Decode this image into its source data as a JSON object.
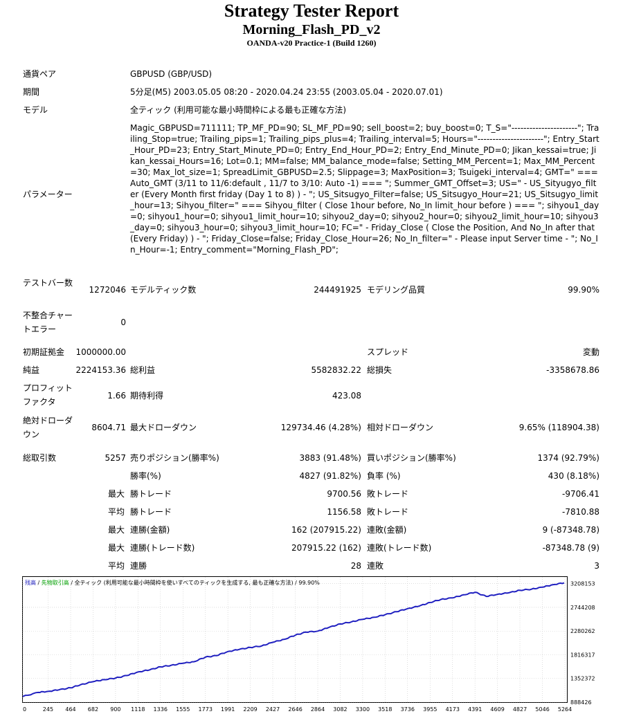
{
  "report": {
    "title": "Strategy Tester Report",
    "ea_name": "Morning_Flash_PD_v2",
    "server": "OANDA-v20 Practice-1 (Build 1260)"
  },
  "info": {
    "pair_label": "通貨ペア",
    "pair_value": "GBPUSD (GBP/USD)",
    "period_label": "期間",
    "period_value": "5分足(M5) 2003.05.05 08:20 - 2020.04.24 23:55 (2003.05.04 - 2020.07.01)",
    "model_label": "モデル",
    "model_value": "全ティック (利用可能な最小時間枠による最も正確な方法)",
    "params_label": "パラメーター",
    "params_value": "Magic_GBPUSD=711111; TP_MF_PD=90; SL_MF_PD=90; sell_boost=2; buy_boost=0; T_S=\"----------------------\"; Trailing_Stop=true; Trailing_pips=1; Trailing_pips_plus=4; Trailing_interval=5; Hours=\"----------------------\"; Entry_Start_Hour_PD=23; Entry_Start_Minute_PD=0; Entry_End_Hour_PD=2; Entry_End_Minute_PD=0; Jikan_kessai=true; Jikan_kessai_Hours=16; Lot=0.1; MM=false; MM_balance_mode=false; Setting_MM_Percent=1; Max_MM_Percent=30; Max_lot_size=1; SpreadLimit_GBPUSD=2.5; Slippage=3; MaxPosition=3; Tsuigeki_interval=4; GMT=\" === Auto_GMT (3/11 to 11/6:default , 11/7 to 3/10: Auto -1) === \"; Summer_GMT_Offset=3; US=\" - US_Sityugyo_filter (Every Month first friday (Day 1 to 8) ) - \"; US_Sitsugyo_Filter=false; US_Sitsugyo_Hour=21; US_Sitsugyo_limit_hour=13; Sihyou_filter=\" === Sihyou_filter ( Close 1hour before, No_In limit_hour before ) === \"; sihyou1_day=0; sihyou1_hour=0; sihyou1_limit_hour=10; sihyou2_day=0; sihyou2_hour=0; sihyou2_limit_hour=10; sihyou3_day=0; sihyou3_hour=0; sihyou3_limit_hour=10; FC=\" - Friday_Close ( Close the Position, And No_In after that (Every Friday) ) - \"; Friday_Close=false; Friday_Close_Hour=26; No_In_filter=\" - Please input Server time - \"; No_In_Hour=-1; Entry_comment=\"Morning_Flash_PD\";"
  },
  "stats": {
    "bars_label": "テストバー数",
    "bars_value": "1272046",
    "ticks_label": "モデルティック数",
    "ticks_value": "244491925",
    "quality_label": "モデリング品質",
    "quality_value": "99.90%",
    "mismatch_label": "不整合チャートエラー",
    "mismatch_value": "0",
    "deposit_label": "初期証拠金",
    "deposit_value": "1000000.00",
    "spread_label": "スプレッド",
    "spread_value": "変動",
    "net_label": "純益",
    "net_value": "2224153.36",
    "gross_profit_label": "総利益",
    "gross_profit_value": "5582832.22",
    "gross_loss_label": "総損失",
    "gross_loss_value": "-3358678.86",
    "pf_label": "プロフィットファクタ",
    "pf_value": "1.66",
    "expected_label": "期待利得",
    "expected_value": "423.08",
    "abs_dd_label": "絶対ドローダウン",
    "abs_dd_value": "8604.71",
    "max_dd_label": "最大ドローダウン",
    "max_dd_value": "129734.46 (4.28%)",
    "rel_dd_label": "相対ドローダウン",
    "rel_dd_value": "9.65% (118904.38)",
    "trades_label": "総取引数",
    "trades_value": "5257",
    "short_label": "売りポジション(勝率%)",
    "short_value": "3883 (91.48%)",
    "long_label": "買いポジション(勝率%)",
    "long_value": "1374 (92.79%)",
    "win_label": "勝率(%)",
    "win_value": "4827 (91.82%)",
    "loss_label": "負率 (%)",
    "loss_value": "430 (8.18%)",
    "pre_max": "最大",
    "pre_avg": "平均",
    "max_win_label": "勝トレード",
    "max_win_value": "9700.56",
    "max_loss_label": "敗トレード",
    "max_loss_value": "-9706.41",
    "avg_win_label": "勝トレード",
    "avg_win_value": "1156.58",
    "avg_loss_label": "敗トレード",
    "avg_loss_value": "-7810.88",
    "cons_win_money_label": "連勝(金額)",
    "cons_win_money_value": "162 (207915.22)",
    "cons_loss_money_label": "連敗(金額)",
    "cons_loss_money_value": "9 (-87348.78)",
    "cons_win_trades_label": "連勝(トレード数)",
    "cons_win_trades_value": "207915.22 (162)",
    "cons_loss_trades_label": "連敗(トレード数)",
    "cons_loss_trades_value": "-87348.78 (9)",
    "avg_cons_win_label": "連勝",
    "avg_cons_win_value": "28",
    "avg_cons_loss_label": "連敗",
    "avg_cons_loss_value": "3"
  },
  "chart_data": {
    "type": "line",
    "legend_balance": "残高",
    "legend_sep1": " / ",
    "legend_volume": "先物取引高",
    "legend_sep2": " / ",
    "legend_desc": "全ティック (利用可能な最小時間枠を使いすべてのティックを生成する, 最も正確な方法)",
    "legend_sep3": " / ",
    "legend_quality": "99.90%",
    "colors": {
      "line": "#2020c0",
      "balance_text": "#2020c0",
      "volume_text": "#00a000",
      "grid": "#c8c8c8"
    },
    "x_ticks": [
      "0",
      "245",
      "464",
      "682",
      "900",
      "1118",
      "1336",
      "1555",
      "1773",
      "1991",
      "2209",
      "2427",
      "2646",
      "2864",
      "3082",
      "3300",
      "3518",
      "3736",
      "3955",
      "4173",
      "4391",
      "4609",
      "4827",
      "5046",
      "5264"
    ],
    "y_ticks": [
      "3208153",
      "2744208",
      "2280262",
      "1816317",
      "1352372",
      "888426"
    ],
    "xlim": [
      0,
      5257
    ],
    "ylim": [
      888426,
      3340000
    ],
    "x": [
      0,
      150,
      245,
      350,
      464,
      560,
      682,
      790,
      900,
      1010,
      1118,
      1230,
      1336,
      1440,
      1555,
      1660,
      1773,
      1880,
      1991,
      2100,
      2209,
      2320,
      2427,
      2540,
      2646,
      2750,
      2864,
      2970,
      3082,
      3190,
      3300,
      3410,
      3518,
      3630,
      3736,
      3850,
      3955,
      4060,
      4173,
      4280,
      4391,
      4500,
      4609,
      4720,
      4827,
      4940,
      5046,
      5150,
      5257
    ],
    "y": [
      1000000,
      1080000,
      1100000,
      1130000,
      1170000,
      1230000,
      1290000,
      1330000,
      1360000,
      1410000,
      1480000,
      1520000,
      1580000,
      1610000,
      1650000,
      1680000,
      1770000,
      1800000,
      1880000,
      1920000,
      1960000,
      1990000,
      2060000,
      2120000,
      2200000,
      2260000,
      2280000,
      2350000,
      2420000,
      2460000,
      2510000,
      2550000,
      2600000,
      2660000,
      2720000,
      2770000,
      2840000,
      2900000,
      2930000,
      2990000,
      3040000,
      2960000,
      3000000,
      3030000,
      3080000,
      3100000,
      3140000,
      3190000,
      3224153
    ]
  }
}
